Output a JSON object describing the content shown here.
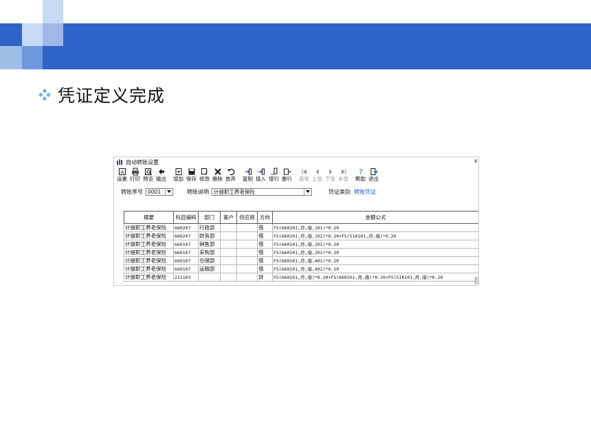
{
  "slide": {
    "heading": "凭证定义完成",
    "colors": {
      "bar": "#2e63c8",
      "squares_light": "#c7daf4",
      "squares_mid": "#6d98dc",
      "bullet": "#7fb0e0"
    }
  },
  "window": {
    "title": "自动转账设置",
    "close_label": "x",
    "toolbar": [
      {
        "label": "设置",
        "icon": "setup-icon",
        "enabled": true
      },
      {
        "label": "打印",
        "icon": "print-icon",
        "enabled": true
      },
      {
        "label": "预览",
        "icon": "preview-icon",
        "enabled": true
      },
      {
        "label": "输出",
        "icon": "export-icon",
        "enabled": true
      },
      {
        "label": "增加",
        "icon": "add-icon",
        "enabled": true
      },
      {
        "label": "保存",
        "icon": "save-icon",
        "enabled": true
      },
      {
        "label": "修改",
        "icon": "edit-icon",
        "enabled": true
      },
      {
        "label": "删除",
        "icon": "delete-icon",
        "enabled": true
      },
      {
        "label": "放弃",
        "icon": "undo-icon",
        "enabled": true
      },
      {
        "label": "复制",
        "icon": "copy-row-icon",
        "enabled": true
      },
      {
        "label": "插入",
        "icon": "insert-row-icon",
        "enabled": true
      },
      {
        "label": "增行",
        "icon": "add-row-icon",
        "enabled": true
      },
      {
        "label": "删行",
        "icon": "delete-row-icon",
        "enabled": true
      },
      {
        "label": "首张",
        "icon": "first-icon",
        "enabled": false
      },
      {
        "label": "上张",
        "icon": "prev-icon",
        "enabled": false
      },
      {
        "label": "下张",
        "icon": "next-icon",
        "enabled": false
      },
      {
        "label": "末张",
        "icon": "last-icon",
        "enabled": false
      },
      {
        "label": "帮助",
        "icon": "help-icon",
        "enabled": true
      },
      {
        "label": "退出",
        "icon": "exit-icon",
        "enabled": true
      }
    ],
    "form": {
      "seq_label": "转账序号",
      "seq_value": "0001",
      "desc_label": "转账说明",
      "desc_value": "计提职工养老保险",
      "type_label": "凭证类别",
      "type_value": "转账凭证"
    },
    "table": {
      "headers": [
        "摘要",
        "科目编码",
        "部门",
        "客户",
        "供应商",
        "方向",
        "金额公式"
      ],
      "rows": [
        {
          "summary": "计提职工养老保险",
          "code": "660207",
          "dept": "行政部",
          "customer": "",
          "supplier": "",
          "dir": "借",
          "formula": "FS(660201,月,借,101)*0.20"
        },
        {
          "summary": "计提职工养老保险",
          "code": "660207",
          "dept": "财务部",
          "customer": "",
          "supplier": "",
          "dir": "借",
          "formula": "FS(660201,月,借,102)*0.20+FS(510101,月,借)*0.20"
        },
        {
          "summary": "计提职工养老保险",
          "code": "660107",
          "dept": "销售部",
          "customer": "",
          "supplier": "",
          "dir": "借",
          "formula": "FS(660101,月,借,201)*0.20"
        },
        {
          "summary": "计提职工养老保险",
          "code": "660107",
          "dept": "采购部",
          "customer": "",
          "supplier": "",
          "dir": "借",
          "formula": "FS(660101,月,借,202)*0.20"
        },
        {
          "summary": "计提职工养老保险",
          "code": "660107",
          "dept": "仓储部",
          "customer": "",
          "supplier": "",
          "dir": "借",
          "formula": "FS(660101,月,借,401)*0.20"
        },
        {
          "summary": "计提职工养老保险",
          "code": "660107",
          "dept": "运输部",
          "customer": "",
          "supplier": "",
          "dir": "借",
          "formula": "FS(660101,月,借,402)*0.20"
        },
        {
          "summary": "计提职工养老保险",
          "code": "221103",
          "dept": "",
          "customer": "",
          "supplier": "",
          "dir": "贷",
          "formula": "FS(660101,月,借)*0.20+FS(660201,月,借)*0.20+FS(510101,月,借)*0.20"
        }
      ]
    }
  }
}
